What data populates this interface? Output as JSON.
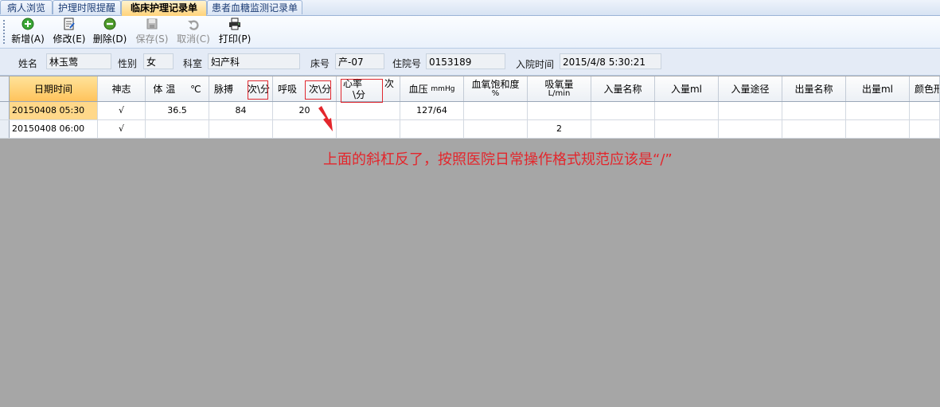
{
  "tabs": [
    {
      "label": "病人浏览"
    },
    {
      "label": "护理时限提醒"
    },
    {
      "label": "临床护理记录单"
    },
    {
      "label": "患者血糖监测记录单"
    }
  ],
  "toolbar": {
    "new": "新增(A)",
    "edit": "修改(E)",
    "delete": "删除(D)",
    "save": "保存(S)",
    "cancel": "取消(C)",
    "print": "打印(P)"
  },
  "patient": {
    "name_label": "姓名",
    "name": "林玉莺",
    "sex_label": "性别",
    "sex": "女",
    "dept_label": "科室",
    "dept": "妇产科",
    "bed_label": "床号",
    "bed": "产-07",
    "admission_no_label": "住院号",
    "admission_no": "0153189",
    "admit_time_label": "入院时间",
    "admit_time": "2015/4/8 5:30:21"
  },
  "columns": {
    "datetime": "日期时间",
    "mind": "神志",
    "temp_a": "体 温",
    "temp_b": "℃",
    "pulse_a": "脉搏",
    "pulse_b": "次\\分",
    "resp_a": "呼吸",
    "resp_b": "次\\分",
    "hr_a": "心率",
    "hr_b": "次",
    "hr_c": "\\分",
    "bp_a": "血压",
    "bp_b": "mmHg",
    "spo2_a": "血氧饱和度",
    "spo2_b": "%",
    "o2_a": "吸氧量",
    "o2_b": "L/min",
    "in_name": "入量名称",
    "in_ml": "入量ml",
    "in_route": "入量途径",
    "out_name": "出量名称",
    "out_ml": "出量ml",
    "color": "颜色形"
  },
  "rows": [
    {
      "datetime": "20150408 05:30",
      "mind": "√",
      "temp": "36.5",
      "pulse": "84",
      "resp": "20",
      "hr": "",
      "bp": "127/64",
      "spo2": "",
      "o2": ""
    },
    {
      "datetime": "20150408 06:00",
      "mind": "√",
      "temp": "",
      "pulse": "",
      "resp": "",
      "hr": "",
      "bp": "",
      "spo2": "",
      "o2": "2"
    }
  ],
  "annotation": "上面的斜杠反了，按照医院日常操作格式规范应该是“/”",
  "colors": {
    "annotation": "#e3262c",
    "active_tab": "#ffd37a",
    "workspace": "#a6a6a6"
  }
}
